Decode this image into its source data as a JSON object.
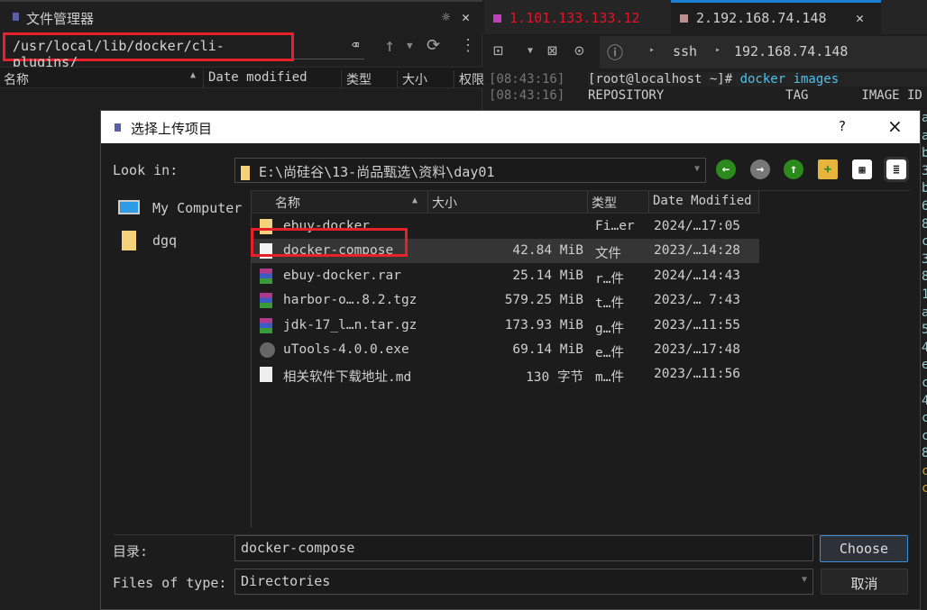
{
  "left_panel": {
    "title": "文件管理器",
    "path": "/usr/local/lib/docker/cli-plugins/",
    "columns": [
      "名称",
      "Date modified",
      "类型",
      "大小",
      "权限"
    ]
  },
  "terminal": {
    "tabs": [
      {
        "label": "1.101.133.133.12",
        "color": "#e81123",
        "marker": "#c040c0"
      },
      {
        "label": "2.192.168.74.148",
        "color": "#d0d0d0",
        "marker": "#b89090"
      }
    ],
    "breadcrumb": [
      "ssh",
      "192.168.74.148"
    ],
    "lines": [
      {
        "time": "[08:43:16]",
        "prompt": "[root@localhost ~]# ",
        "cmd": "docker images"
      },
      {
        "time": "[08:43:16]",
        "text": "REPOSITORY                TAG       IMAGE ID"
      }
    ],
    "edge_chars": [
      "a",
      "a",
      "b",
      "3",
      "b",
      "6",
      "8",
      "c",
      "3",
      "8",
      "1",
      "a",
      "5",
      "4",
      "e",
      "c",
      "4",
      "c",
      "c",
      "8",
      "c",
      "c"
    ]
  },
  "dialog": {
    "title": "选择上传项目",
    "help": "?",
    "close": "×",
    "look_in_label": "Look in:",
    "look_in_value": "E:\\尚硅谷\\13-尚品甄选\\资料\\day01",
    "sidebar": [
      {
        "label": "My Computer",
        "icon": "computer-icon"
      },
      {
        "label": "dgq",
        "icon": "user-folder-icon"
      }
    ],
    "columns": [
      "名称",
      "大小",
      "类型",
      "Date Modified"
    ],
    "files": [
      {
        "name": "ebuy-docker",
        "size": "",
        "type": "Fi…er",
        "date": "2024/…17:05",
        "icon": "folder"
      },
      {
        "name": "docker-compose",
        "size": "42.84 MiB",
        "type": "文件",
        "date": "2023/…14:28",
        "icon": "file",
        "selected": true
      },
      {
        "name": "ebuy-docker.rar",
        "size": "25.14 MiB",
        "type": "r…件",
        "date": "2024/…14:43",
        "icon": "archive"
      },
      {
        "name": "harbor-o….8.2.tgz",
        "size": "579.25 MiB",
        "type": "t…件",
        "date": "2023/… 7:43",
        "icon": "archive"
      },
      {
        "name": "jdk-17_l…n.tar.gz",
        "size": "173.93 MiB",
        "type": "g…件",
        "date": "2023/…11:55",
        "icon": "archive"
      },
      {
        "name": "uTools-4.0.0.exe",
        "size": "69.14 MiB",
        "type": "e…件",
        "date": "2023/…17:48",
        "icon": "exe"
      },
      {
        "name": "相关软件下载地址.md",
        "size": "130 字节",
        "type": "m…件",
        "date": "2023/…11:56",
        "icon": "markdown"
      }
    ],
    "dir_label": "目录:",
    "dir_value": "docker-compose",
    "type_label": "Files of type:",
    "type_value": "Directories",
    "choose": "Choose",
    "cancel": "取消"
  }
}
